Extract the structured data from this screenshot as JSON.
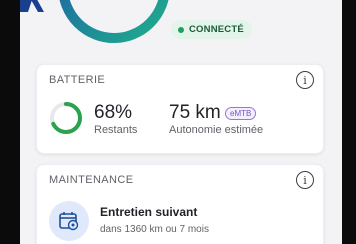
{
  "header": {
    "logo_icon": "brand-logo-icon",
    "progress_ring_icon": "progress-ring-icon",
    "status": {
      "label": "CONNECTÉ",
      "color": "#1fa05a"
    }
  },
  "battery_card": {
    "title": "BATTERIE",
    "info_icon": "info-icon",
    "info_glyph": "i",
    "charge": {
      "percent": 68,
      "percent_label": "68%",
      "sub_label": "Restants",
      "ring_color": "#2aa24e"
    },
    "range": {
      "value_label": "75 km",
      "mode_badge": "eMTB",
      "sub_label": "Autonomie estimée"
    }
  },
  "maintenance_card": {
    "title": "MAINTENANCE",
    "info_icon": "info-icon",
    "info_glyph": "i",
    "next_service": {
      "icon": "calendar-gear-icon",
      "title": "Entretien suivant",
      "sub_label": "dans 1360 km ou 7 mois"
    }
  },
  "colors": {
    "accent_blue": "#1e5aa8",
    "accent_teal": "#1fae8c",
    "badge_purple": "#7b4fc8"
  }
}
